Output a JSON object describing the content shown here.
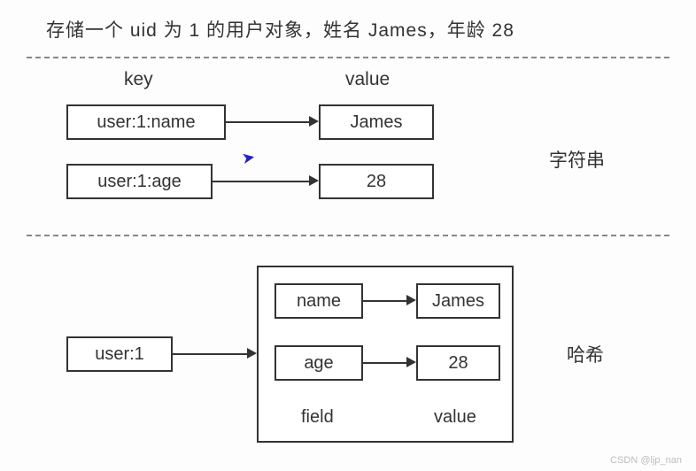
{
  "title": "存储一个 uid 为 1 的用户对象，姓名 James，年龄 28",
  "headers": {
    "key": "key",
    "value": "value"
  },
  "string_section": {
    "label": "字符串",
    "rows": [
      {
        "key": "user:1:name",
        "value": "James"
      },
      {
        "key": "user:1:age",
        "value": "28"
      }
    ]
  },
  "hash_section": {
    "label": "哈希",
    "key": "user:1",
    "fields": [
      {
        "field": "name",
        "value": "James"
      },
      {
        "field": "age",
        "value": "28"
      }
    ],
    "sub_labels": {
      "field": "field",
      "value": "value"
    }
  },
  "watermark": "CSDN @ljp_nan"
}
